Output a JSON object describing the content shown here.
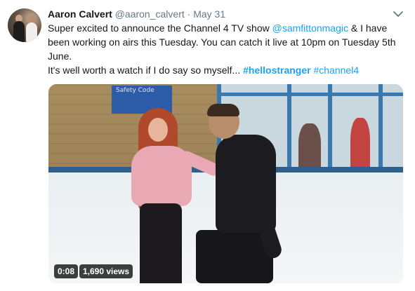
{
  "author": {
    "name": "Aaron Calvert",
    "handle": "@aaron_calvert",
    "separator": "·",
    "date": "May 31"
  },
  "tweet": {
    "line1_pre": "Super excited to announce the Channel 4 TV show ",
    "mention": "@samfittonmagic",
    "line1_post": " & I have been working on airs this Tuesday. You can catch it live at 10pm on Tuesday 5th June.",
    "line2_pre": "It's well worth a watch if I do say so myself... ",
    "hashtag1": "#hellostranger",
    "line2_mid": " ",
    "hashtag2": "#channel4"
  },
  "video": {
    "sign_text": "Safety Code",
    "duration": "0:08",
    "views": "1,690 views"
  },
  "colors": {
    "link": "#1da1f2",
    "text": "#14171a",
    "meta": "#657786"
  },
  "icons": {
    "menu": "chevron-down-icon"
  }
}
